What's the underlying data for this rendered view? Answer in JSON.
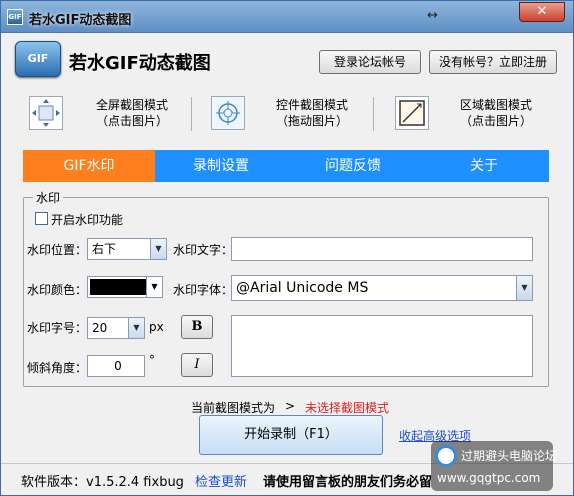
{
  "window": {
    "title": "若水GIF动态截图",
    "close": "✕",
    "resize": "↔"
  },
  "header": {
    "logo_text": "GIF",
    "app_name": "若水GIF动态截图",
    "login": "登录论坛帐号",
    "register": "没有帐号？立即注册"
  },
  "modes": [
    {
      "title": "全屏截图模式",
      "sub": "（点击图片）",
      "icon": "fullscreen-capture-icon"
    },
    {
      "title": "控件截图模式",
      "sub": "（拖动图片）",
      "icon": "crosshair-icon"
    },
    {
      "title": "区域截图模式",
      "sub": "（点击图片）",
      "icon": "region-capture-icon"
    }
  ],
  "tabs": [
    "GIF水印",
    "录制设置",
    "问题反馈",
    "关于"
  ],
  "active_tab": 0,
  "watermark": {
    "group_title": "水印",
    "enable_label": "开启水印功能",
    "enabled": false,
    "position_label": "水印位置：",
    "position_value": "右下",
    "text_label": "水印文字：",
    "text_value": "",
    "color_label": "水印颜色：",
    "color_value": "#000000",
    "font_label": "水印字体：",
    "font_value": "@Arial Unicode MS",
    "size_label": "水印字号：",
    "size_value": "20",
    "size_unit": "px",
    "bold_label": "B",
    "italic_label": "I",
    "angle_label": "倾斜角度：",
    "angle_value": "0",
    "angle_unit": "°"
  },
  "status": {
    "label": "当前截图模式为",
    "arrow": ">",
    "value": "未选择截图模式",
    "value_color": "#e02020"
  },
  "actions": {
    "start": "开始录制（F1）",
    "collapse": "收起高级选项"
  },
  "footer": {
    "version": "软件版本：v1.5.2.4 fixbug",
    "check_update": "检查更新",
    "notice": "请使用留言板的朋友们务必留"
  },
  "watermark_overlay": {
    "line1": "过期避头电脑论坛",
    "line2": "www.gqgtpc.com"
  },
  "colors": {
    "tab_bar": "#1e90ff",
    "tab_active": "#ff7f1e",
    "title_bar": "#5d8fc4"
  }
}
